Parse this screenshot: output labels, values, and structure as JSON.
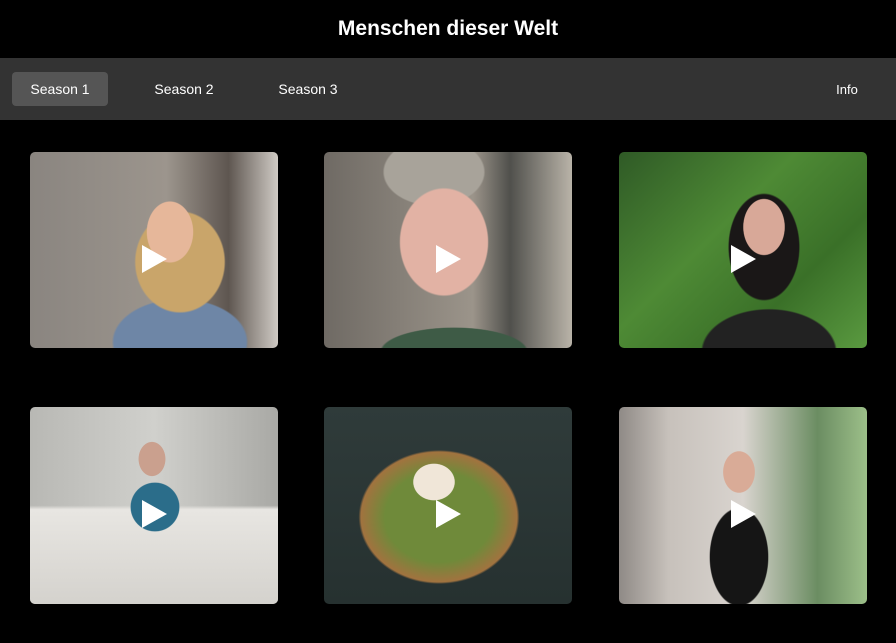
{
  "header": {
    "title": "Menschen dieser Welt"
  },
  "nav": {
    "tabs": [
      {
        "label": "Season 1",
        "active": true
      },
      {
        "label": "Season 2",
        "active": false
      },
      {
        "label": "Season 3",
        "active": false
      }
    ],
    "info_label": "Info"
  },
  "videos": [
    {
      "icon": "play-icon"
    },
    {
      "icon": "play-icon"
    },
    {
      "icon": "play-icon"
    },
    {
      "icon": "play-icon"
    },
    {
      "icon": "play-icon"
    },
    {
      "icon": "play-icon"
    }
  ],
  "colors": {
    "background": "#000000",
    "nav_background": "#333333",
    "active_tab": "#555555",
    "text": "#ffffff"
  }
}
